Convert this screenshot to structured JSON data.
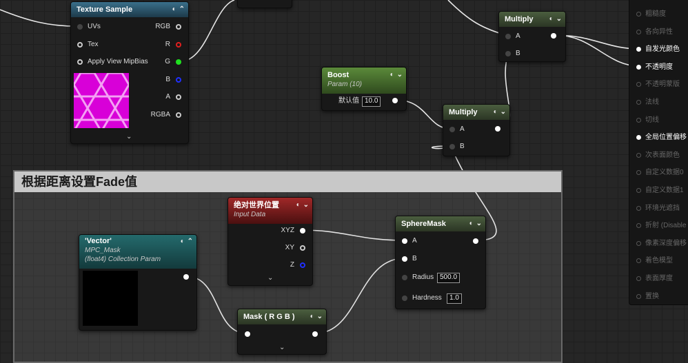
{
  "comment_box": {
    "title": "根据距离设置Fade值"
  },
  "texture_sample": {
    "title": "Texture Sample",
    "inputs": [
      "UVs",
      "Tex",
      "Apply View MipBias"
    ],
    "outputs": [
      "RGB",
      "R",
      "G",
      "B",
      "A",
      "RGBA"
    ]
  },
  "boost": {
    "title": "Boost",
    "subtitle": "Param (10)",
    "param_label": "默认值",
    "param_value": "10.0"
  },
  "multiply_top": {
    "title": "Multiply",
    "inputs": [
      "A",
      "B"
    ]
  },
  "multiply_mid": {
    "title": "Multiply",
    "inputs": [
      "A",
      "B"
    ]
  },
  "world_pos": {
    "title": "绝对世界位置",
    "subtitle": "Input Data",
    "outputs": [
      "XYZ",
      "XY",
      "Z"
    ]
  },
  "vector_param": {
    "title": "'Vector'",
    "subtitle1": "MPC_Mask",
    "subtitle2": "(float4) Collection Param"
  },
  "mask_node": {
    "title": "Mask ( R G B )"
  },
  "sphere_mask": {
    "title": "SphereMask",
    "inputs": [
      "A",
      "B"
    ],
    "radius_label": "Radius",
    "radius_value": "500.0",
    "hardness_label": "Hardness",
    "hardness_value": "1.0"
  },
  "result_node": {
    "items": [
      "粗糙度",
      "各向异性",
      "自发光颜色",
      "不透明度",
      "不透明蒙版",
      "法线",
      "切线",
      "全局位置偏移",
      "次表面颜色",
      "自定义数据0",
      "自定义数据1",
      "环境光遮挡",
      "折射 (Disable",
      "像素深度偏移",
      "着色模型",
      "表面厚度",
      "置换"
    ],
    "active": [
      false,
      false,
      true,
      true,
      false,
      false,
      false,
      true,
      false,
      false,
      false,
      false,
      false,
      false,
      false,
      false,
      false
    ]
  },
  "colors": {
    "pin_red": "#e02020",
    "pin_green": "#20e020",
    "pin_blue": "#2030ff",
    "swatch": "#d800d8"
  }
}
